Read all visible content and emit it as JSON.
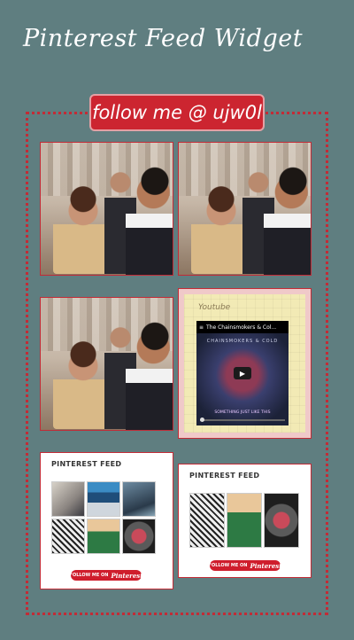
{
  "page": {
    "title": "Pinterest Feed Widget"
  },
  "banner": {
    "label": "follow me @ ujw0l"
  },
  "youtube": {
    "label": "Youtube",
    "video_title": "The Chainsmokers & Col...",
    "art_title": "CHAINSMOKERS & COLD",
    "art_subtitle": "SOMETHING JUST LIKE THIS"
  },
  "feed_large": {
    "title": "PINTEREST FEED",
    "follow_label": "FOLLOW ME ON",
    "brand": "Pinterest"
  },
  "feed_small": {
    "title": "PINTEREST FEED",
    "follow_label": "FOLLOW ME ON",
    "brand": "Pinterest"
  },
  "colors": {
    "background": "#5f7e80",
    "accent": "#cc2530",
    "frame": "#c22b36"
  }
}
